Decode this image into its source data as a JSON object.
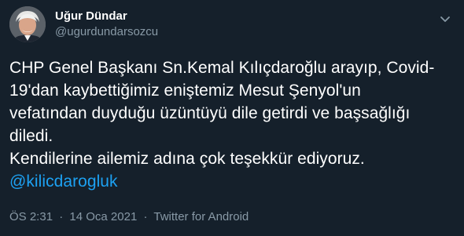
{
  "author": {
    "display_name": "Uğur Dündar",
    "handle": "@ugurdundarsozcu",
    "avatar": "profile-photo"
  },
  "header": {
    "more_icon": "chevron-down-icon"
  },
  "tweet": {
    "text_lines": [
      "CHP Genel Başkanı Sn.Kemal Kılıçdaroğlu arayıp, Covid-",
      "19'dan kaybettiğimiz eniştemiz Mesut Şenyol'un",
      "vefatından duyduğu üzüntüyü dile getirdi ve başsağlığı",
      "diledi."
    ],
    "text_line_2": "Kendilerine ailemiz adına çok teşekkür ediyoruz.",
    "mention": "@kilicdarogluk"
  },
  "meta": {
    "time": "ÖS 2:31",
    "separator": "·",
    "date": "14 Oca 2021",
    "source": "Twitter for Android"
  },
  "colors": {
    "background": "#15202b",
    "text": "#ffffff",
    "secondary": "#8899a6",
    "link": "#1da1f2"
  }
}
